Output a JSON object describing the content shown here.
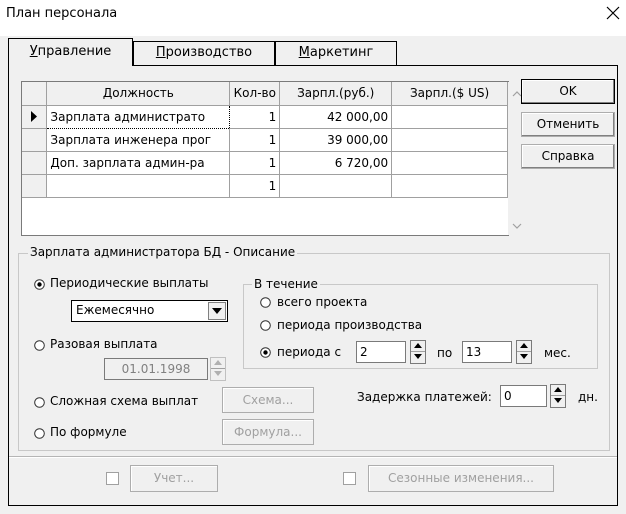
{
  "window": {
    "title": "План персонала"
  },
  "tabs": [
    {
      "label": "Управление",
      "hotkey": "У",
      "rest": "правление"
    },
    {
      "label": "Производство",
      "hotkey": "П",
      "rest": "роизводство"
    },
    {
      "label": "Маркетинг",
      "hotkey": "М",
      "rest": "аркетинг"
    }
  ],
  "grid": {
    "columns": [
      "Должность",
      "Кол-во",
      "Зарпл.(руб.)",
      "Зарпл.($ US)"
    ],
    "rows": [
      {
        "name": "Зарплата администрато",
        "qty": "1",
        "rub": "42 000,00",
        "usd": ""
      },
      {
        "name": "Зарплата инженера прог",
        "qty": "1",
        "rub": "39 000,00",
        "usd": ""
      },
      {
        "name": "Доп. зарплата админ-ра",
        "qty": "1",
        "rub": "6 720,00",
        "usd": ""
      },
      {
        "name": "",
        "qty": "1",
        "rub": "",
        "usd": ""
      }
    ]
  },
  "buttons": {
    "ok": "OK",
    "cancel": "Отменить",
    "help": "Справка",
    "scheme": "Схема...",
    "formula": "Формула...",
    "account": "Учет...",
    "seasonal": "Сезонные изменения..."
  },
  "description": {
    "title": "Зарплата администратора БД - Описание",
    "periodic_label": "Периодические выплаты",
    "periodic_selected": true,
    "frequency_value": "Ежемесячно",
    "single_label": "Разовая выплата",
    "single_date": "01.01.1998",
    "complex_label": "Сложная схема выплат",
    "formula_label": "По формуле",
    "during": {
      "title": "В течение",
      "whole_project": "всего проекта",
      "production_period": "периода производства",
      "period_from": "периода с",
      "from_value": "2",
      "to_label": "по",
      "to_value": "13",
      "unit": "мес."
    },
    "delay": {
      "label": "Задержка платежей:",
      "value": "0",
      "unit": "дн."
    }
  }
}
